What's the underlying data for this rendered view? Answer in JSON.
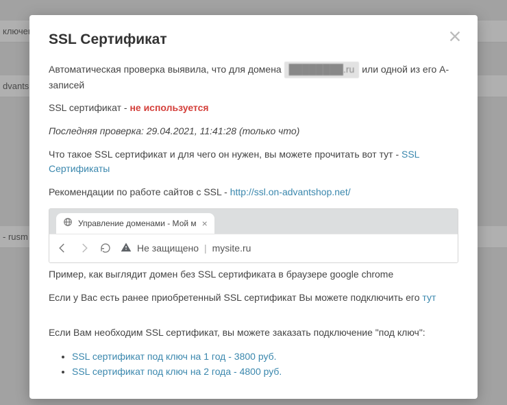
{
  "bg": {
    "r1": "ключен",
    "r2": "dvantsl",
    "r3": "- rusm"
  },
  "modal": {
    "title": "SSL Сертификат",
    "intro_pre": "Автоматическая проверка выявила, что для домена ",
    "domain_masked": "████████.ru",
    "intro_post": " или одной из его A-записей",
    "line2_pre": "SSL сертификат - ",
    "status": "не используется",
    "lastcheck": "Последняя проверка: 29.04.2021, 11:41:28 (только что)",
    "whatssl_pre": "Что такое SSL сертификат и для чего он нужен, вы можете прочитать вот тут - ",
    "whatssl_link": "SSL Сертификаты",
    "rec_pre": "Рекомендации по работе сайтов с SSL - ",
    "rec_link": "http://ssl.on-advantshop.net/",
    "caption": "Пример, как выглядит домен без SSL сертификата в браузере google chrome",
    "existing_pre": "Если у Вас есть ранее приобретенный SSL сертификат Вы можете подключить его ",
    "existing_link": "тут",
    "order_intro": "Если Вам необходим SSL сертификат, вы можете заказать подключение \"под ключ\":",
    "offers": [
      "SSL сертификат под ключ на 1 год - 3800 руб.",
      "SSL сертификат под ключ на 2 года - 4800 руб."
    ]
  },
  "browser": {
    "tab_title": "Управление доменами - Мой м",
    "insecure_label": "Не защищено",
    "url_host": "mysite.ru"
  }
}
